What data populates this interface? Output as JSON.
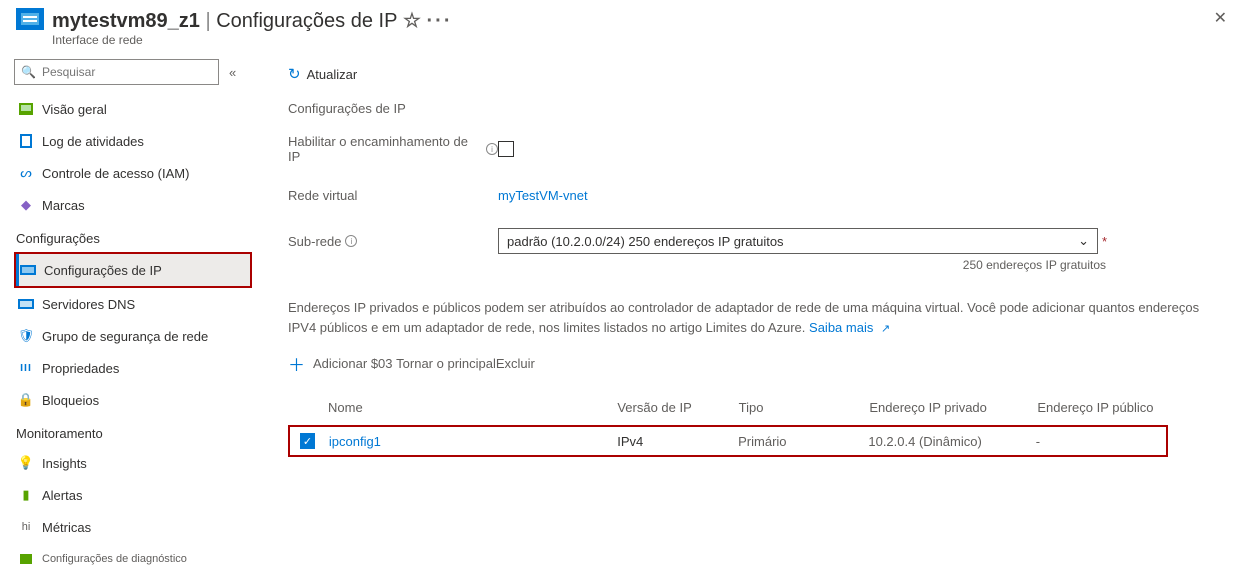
{
  "header": {
    "resource_name": "mytestvm89_z1",
    "page_title": "Configurações de IP",
    "subtitle": "Interface de rede"
  },
  "search": {
    "placeholder": "Pesquisar"
  },
  "nav": {
    "overview": "Visão geral",
    "activity_log": "Log de atividades",
    "iam": "Controle de acesso (IAM)",
    "tags": "Marcas",
    "group_settings": "Configurações",
    "ip_config": "Configurações de IP",
    "dns": "Servidores DNS",
    "nsg": "Grupo de segurança de rede",
    "properties": "Propriedades",
    "locks": "Bloqueios",
    "group_monitoring": "Monitoramento",
    "insights": "Insights",
    "alerts": "Alertas",
    "metrics": "Métricas",
    "diag": "Configurações de diagnóstico"
  },
  "toolbar": {
    "refresh": "Atualizar"
  },
  "form": {
    "section": "Configurações de IP",
    "ip_forward_label": "Habilitar o encaminhamento de IP",
    "vnet_label": "Rede virtual",
    "vnet_value": "myTestVM-vnet",
    "subnet_label": "Sub-rede",
    "subnet_value": "padrão (10.2.0.0/24) 250 endereços IP gratuitos",
    "subnet_note": "250 endereços IP gratuitos"
  },
  "description": {
    "line": "Endereços IP privados e públicos podem ser atribuídos ao controlador de adaptador de rede de uma máquina virtual. Você pode adicionar quantos endereços IPV4 públicos e em um adaptador de rede, nos limites listados no artigo Limites do Azure.",
    "link": "Saiba mais"
  },
  "actions": {
    "add": "Adicionar",
    "make_primary": "Tornar o principal",
    "delete": "Excluir",
    "between": "$03"
  },
  "table": {
    "headers": {
      "name": "Nome",
      "ip_version": "Versão de IP",
      "type": "Tipo",
      "private_ip": "Endereço IP privado",
      "public_ip": "Endereço IP público"
    },
    "rows": [
      {
        "name": "ipconfig1",
        "version": "IPv4",
        "type": "Primário",
        "private": "10.2.0.4 (Dinâmico)",
        "public": "-"
      }
    ]
  },
  "nav_hi": "hi"
}
